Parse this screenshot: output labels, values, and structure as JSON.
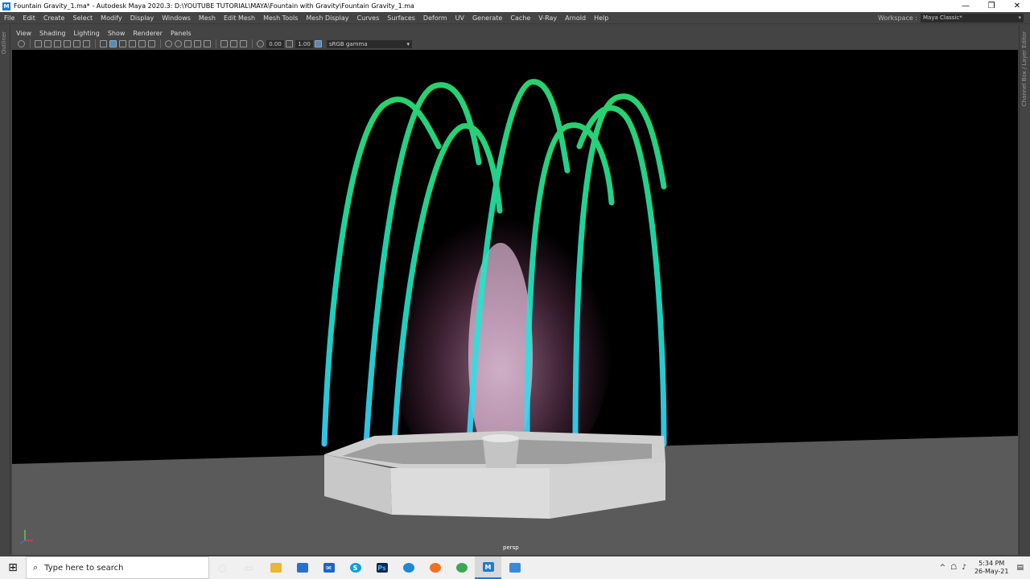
{
  "window": {
    "title": "Fountain Gravity_1.ma* - Autodesk Maya 2020.3: D:\\YOUTUBE TUTORIAL\\MAYA\\Fountain with Gravity\\Fountain Gravity_1.ma",
    "app_icon": "M",
    "controls": [
      "—",
      "❐",
      "✕"
    ]
  },
  "menubar": {
    "items": [
      "File",
      "Edit",
      "Create",
      "Select",
      "Modify",
      "Display",
      "Windows",
      "Mesh",
      "Edit Mesh",
      "Mesh Tools",
      "Mesh Display",
      "Curves",
      "Surfaces",
      "Deform",
      "UV",
      "Generate",
      "Cache",
      "V-Ray",
      "Arnold",
      "Help"
    ],
    "workspace_label": "Workspace :",
    "workspace_value": "Maya Classic*"
  },
  "side_panels": {
    "left": "Outliner",
    "right": "Channel Box / Layer Editor"
  },
  "panel_menu": [
    "View",
    "Shading",
    "Lighting",
    "Show",
    "Renderer",
    "Panels"
  ],
  "toolbar": {
    "exposure": "0.00",
    "gamma": "1.00",
    "color_space": "sRGB gamma"
  },
  "viewport": {
    "camera_label": "persp",
    "fountain_jet_color": "#1fe8c8",
    "center_spray_color": "#ffb0e8",
    "floor_color": "#5a5a5a",
    "basin_color": "#d8d8d8"
  },
  "taskbar": {
    "search_placeholder": "Type here to search",
    "time": "5:34 PM",
    "date": "26-May-21",
    "apps": [
      "cortana-icon",
      "task-view-icon",
      "file-explorer-icon",
      "store-icon",
      "mail-icon",
      "skype-icon",
      "photoshop-icon",
      "edge-icon",
      "firefox-icon",
      "chrome-icon",
      "maya-icon",
      "remote-icon"
    ]
  }
}
